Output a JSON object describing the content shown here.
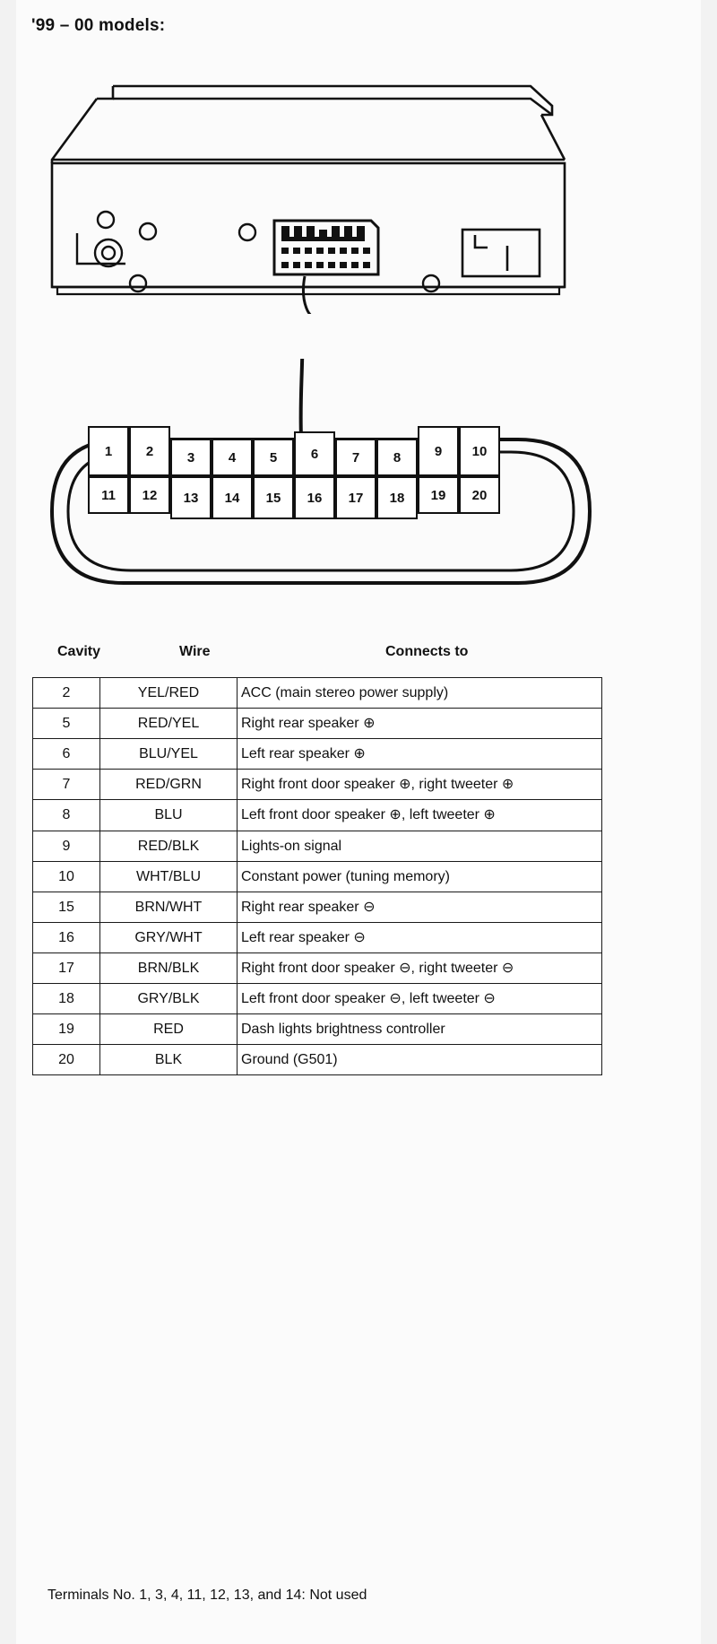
{
  "document": {
    "title": "'99 – 00 models:",
    "footnote": "Terminals No. 1, 3, 4, 11, 12, 13, and 14: Not used"
  },
  "connector": {
    "top_row": [
      "1",
      "2",
      "3",
      "4",
      "5",
      "6",
      "7",
      "8",
      "9",
      "10"
    ],
    "bottom_row": [
      "11",
      "12",
      "13",
      "14",
      "15",
      "16",
      "17",
      "18",
      "19",
      "20"
    ]
  },
  "table": {
    "headers": {
      "cavity": "Cavity",
      "wire": "Wire",
      "connects_to": "Connects to"
    },
    "rows": [
      {
        "cavity": "2",
        "wire": "YEL/RED",
        "connects_to": "ACC (main stereo power supply)"
      },
      {
        "cavity": "5",
        "wire": "RED/YEL",
        "connects_to": "Right rear speaker ⊕"
      },
      {
        "cavity": "6",
        "wire": "BLU/YEL",
        "connects_to": "Left rear speaker ⊕"
      },
      {
        "cavity": "7",
        "wire": "RED/GRN",
        "connects_to": "Right front door speaker ⊕, right tweeter ⊕"
      },
      {
        "cavity": "8",
        "wire": "BLU",
        "connects_to": "Left front door speaker ⊕, left tweeter ⊕"
      },
      {
        "cavity": "9",
        "wire": "RED/BLK",
        "connects_to": "Lights-on signal"
      },
      {
        "cavity": "10",
        "wire": "WHT/BLU",
        "connects_to": "Constant power (tuning memory)"
      },
      {
        "cavity": "15",
        "wire": "BRN/WHT",
        "connects_to": "Right rear speaker ⊖"
      },
      {
        "cavity": "16",
        "wire": "GRY/WHT",
        "connects_to": "Left rear speaker ⊖"
      },
      {
        "cavity": "17",
        "wire": "BRN/BLK",
        "connects_to": "Right front door speaker ⊖, right tweeter ⊖"
      },
      {
        "cavity": "18",
        "wire": "GRY/BLK",
        "connects_to": "Left front door speaker ⊖, left tweeter ⊖"
      },
      {
        "cavity": "19",
        "wire": "RED",
        "connects_to": "Dash lights brightness controller"
      },
      {
        "cavity": "20",
        "wire": "BLK",
        "connects_to": "Ground (G501)"
      }
    ]
  },
  "colors": {
    "ink": "#111111",
    "page": "#fbfbfb",
    "margin": "#f2f2f2"
  }
}
